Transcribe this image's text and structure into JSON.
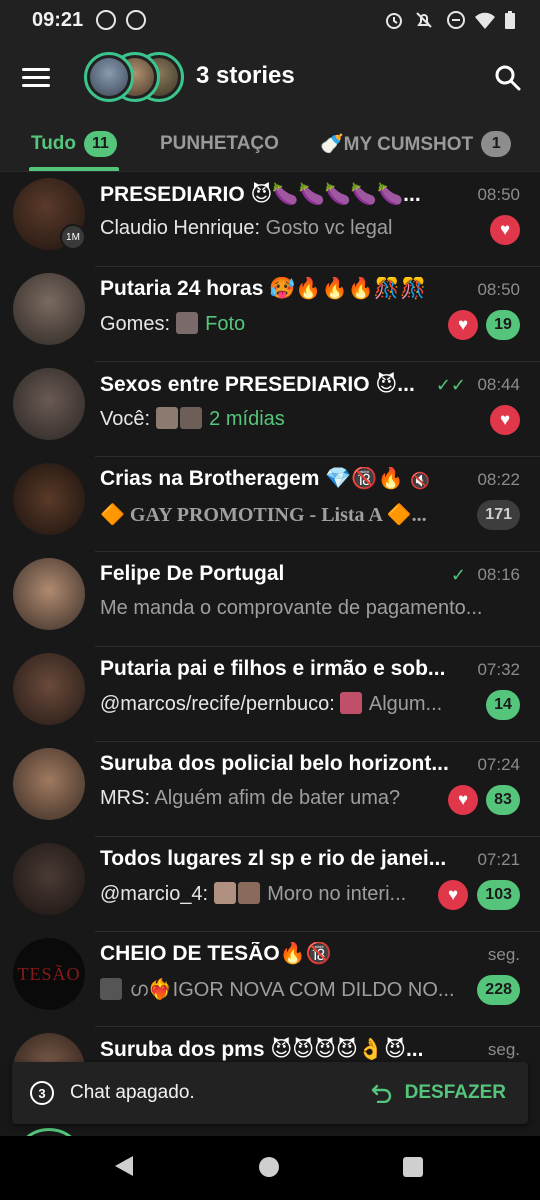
{
  "status_bar": {
    "time": "09:21"
  },
  "toolbar": {
    "stories_title": "3 stories"
  },
  "tabs": [
    {
      "label": "Tudo",
      "count": "11"
    },
    {
      "label": "PUNHETAÇO",
      "count": ""
    },
    {
      "label": "🍼MY CUMSHOT",
      "count": "1"
    }
  ],
  "chats": [
    {
      "title": "PRESEDIARIO 😈🍆🍆🍆🍆🍆...",
      "time": "08:50",
      "sender": "Claudio Henrique:",
      "message": " Gosto vc legal",
      "level": "1M",
      "badge": ""
    },
    {
      "title": "Putaria 24 horas 🥵🔥🔥🔥🎊🎊",
      "time": "08:50",
      "sender": "Gomes:",
      "message": "Foto",
      "badge": "19"
    },
    {
      "title": "Sexos entre PRESEDIARIO 😈...",
      "time": "08:44",
      "sender": "Você:",
      "message": "2 mídias",
      "badge": ""
    },
    {
      "title": "Crias na Brotheragem 💎🔞🔥",
      "time": "08:22",
      "sender": "",
      "message": "🔶 GAY PROMOTING - Lista A 🔶...",
      "badge": "171"
    },
    {
      "title": "Felipe De Portugal",
      "time": "08:16",
      "sender": "",
      "message": "Me manda o comprovante de pagamento...",
      "badge": ""
    },
    {
      "title": "Putaria pai e filhos e irmão e sob...",
      "time": "07:32",
      "sender": "@marcos/recife/pernbuco:",
      "message": " Algum...",
      "badge": "14"
    },
    {
      "title": "Suruba dos policial belo horizont...",
      "time": "07:24",
      "sender": "MRS:",
      "message": " Alguém afim de bater uma?",
      "badge": "83"
    },
    {
      "title": "Todos lugares zl sp e rio de janei...",
      "time": "07:21",
      "sender": "@marcio_4:",
      "message": " Moro no interi...",
      "badge": "103"
    },
    {
      "title": "CHEIO DE TESÃO🔥🔞",
      "time": "seg.",
      "sender": "",
      "message": "ഗ❤️‍🔥IGOR NOVA COM DILDO NO...",
      "badge": "228"
    },
    {
      "title": "Suruba dos pms 😈😈😈😈👌😈...",
      "time": "seg.",
      "sender": "",
      "message": "",
      "badge": ""
    }
  ],
  "snackbar": {
    "count": "3",
    "text": "Chat apagado.",
    "undo_label": "DESFAZER"
  },
  "colors": {
    "accent": "#55c57b",
    "heart": "#e0374b",
    "background": "#181818"
  }
}
